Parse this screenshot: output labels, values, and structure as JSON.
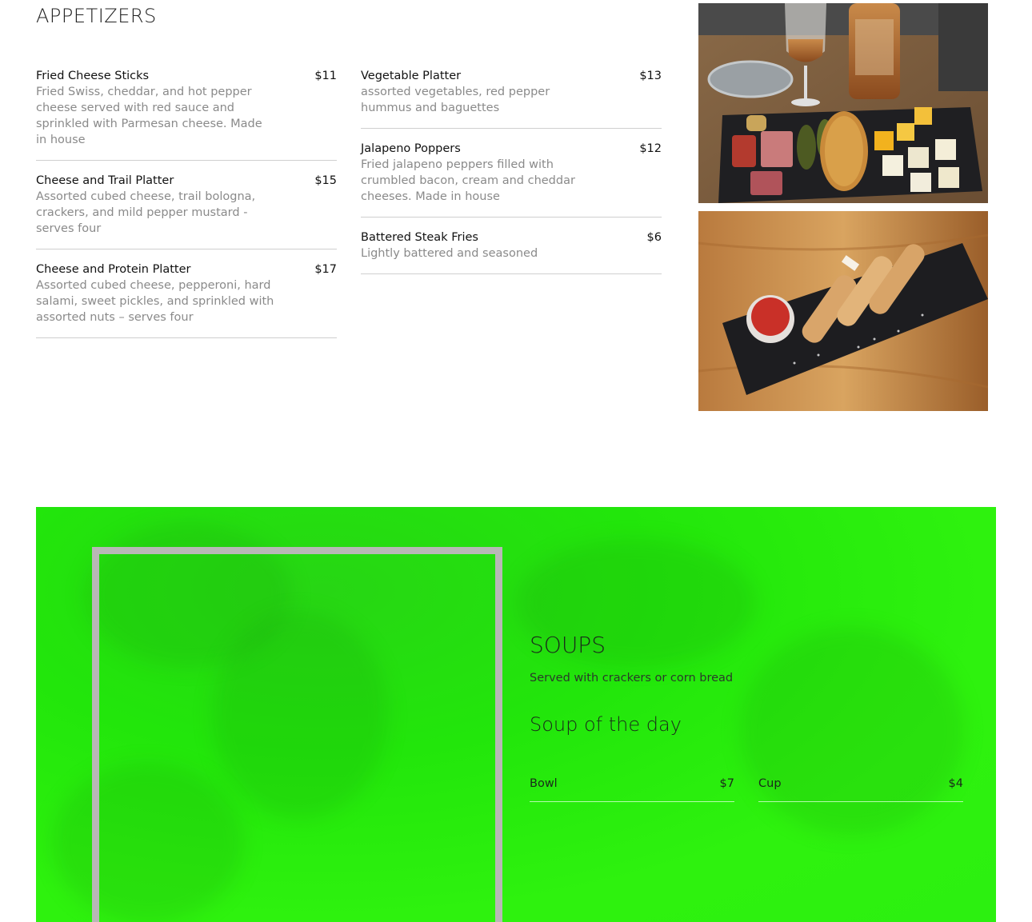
{
  "appetizers": {
    "title": "APPETIZERS",
    "left_items": [
      {
        "name": "Fried Cheese Sticks",
        "price": "$11",
        "desc": "Fried Swiss, cheddar, and hot pepper cheese served with red sauce and sprinkled with Parmesan cheese. Made in house"
      },
      {
        "name": "Cheese and Trail Platter",
        "price": "$15",
        "desc": "Assorted cubed cheese, trail bologna, crackers, and mild pepper mustard -serves four"
      },
      {
        "name": "Cheese and Protein Platter",
        "price": "$17",
        "desc": "Assorted cubed cheese, pepperoni, hard salami, sweet pickles, and sprinkled with assorted nuts – serves four"
      }
    ],
    "right_items": [
      {
        "name": "Vegetable Platter",
        "price": "$13",
        "desc": "assorted vegetables, red pepper hummus and baguettes"
      },
      {
        "name": "Jalapeno Poppers",
        "price": "$12",
        "desc": "Fried jalapeno peppers filled with crumbled bacon, cream and cheddar cheeses. Made in house"
      },
      {
        "name": "Battered Steak Fries",
        "price": "$6",
        "desc": "Lightly battered and seasoned"
      }
    ]
  },
  "photos": [
    {
      "name": "cheese-platter-photo",
      "subject": "wine glasses and cheese platter"
    },
    {
      "name": "cheese-sticks-photo",
      "subject": "fried cheese sticks with red sauce"
    }
  ],
  "soups": {
    "title": "SOUPS",
    "subtitle": "Served with crackers or corn bread",
    "soup_of_day": "Soup of the day",
    "options": [
      {
        "name": "Bowl",
        "price": "$7"
      },
      {
        "name": "Cup",
        "price": "$4"
      }
    ],
    "panel_color": "#2cf010",
    "frame_color": "#b8b8b6"
  }
}
